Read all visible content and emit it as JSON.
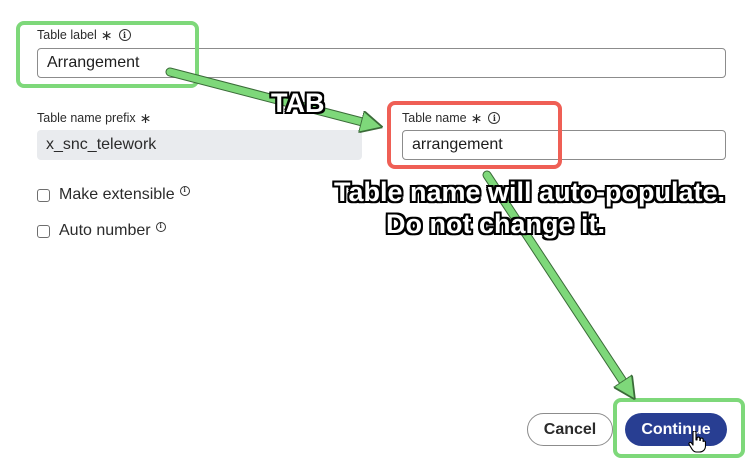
{
  "form": {
    "table_label": {
      "label": "Table label",
      "required_mark": "∗",
      "info_icon": "info-icon",
      "value": "Arrangement"
    },
    "table_name_prefix": {
      "label": "Table name prefix",
      "required_mark": "∗",
      "value": "x_snc_telework"
    },
    "table_name": {
      "label": "Table name",
      "required_mark": "∗",
      "info_icon": "info-icon",
      "value": "arrangement"
    },
    "checkboxes": [
      {
        "label": "Make extensible",
        "checked": false,
        "info_icon": "info-icon"
      },
      {
        "label": "Auto number",
        "checked": false,
        "info_icon": "info-icon"
      }
    ]
  },
  "footer": {
    "cancel_label": "Cancel",
    "continue_label": "Continue"
  },
  "annotations": {
    "tab_label": "TAB",
    "note_line1": "Table name will auto-populate.",
    "note_line2": "Do not change it.",
    "colors": {
      "green_highlight": "#7ed87a",
      "red_highlight": "#ef5f55",
      "arrow_green": "#7ed87a",
      "continue_blue": "#283e92"
    }
  }
}
